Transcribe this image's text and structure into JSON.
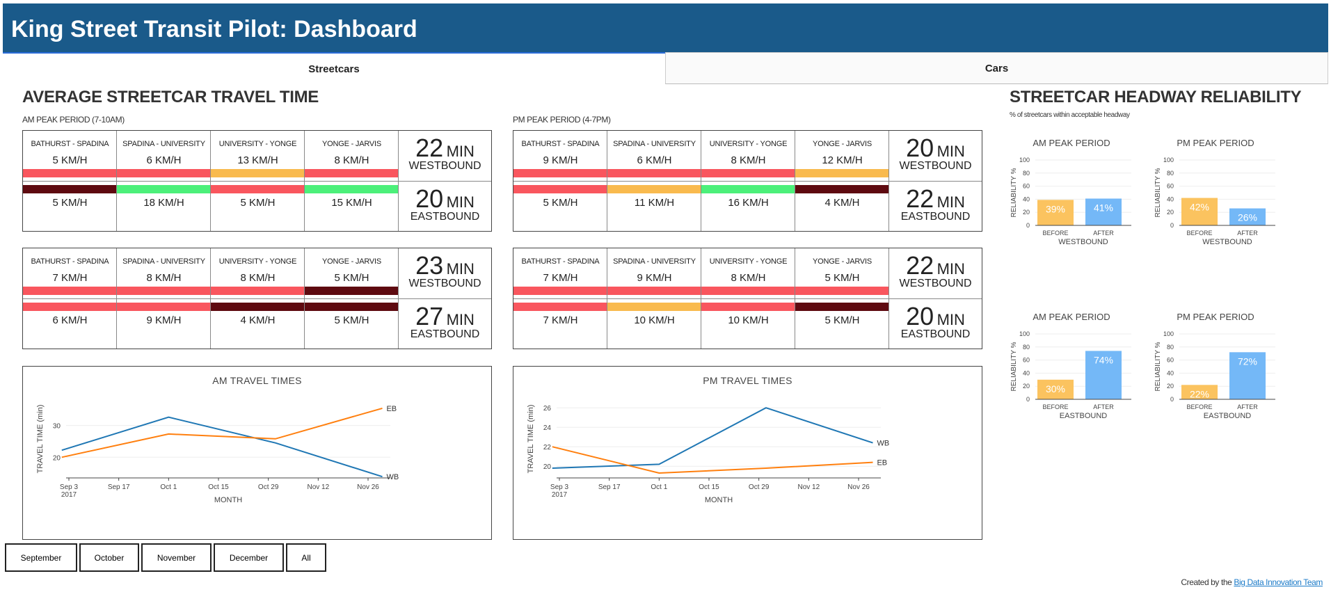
{
  "header": {
    "title": "King Street Transit Pilot: Dashboard"
  },
  "tabs": [
    {
      "label": "Streetcars",
      "active": true
    },
    {
      "label": "Cars",
      "active": false
    }
  ],
  "travel_time": {
    "title": "AVERAGE STREETCAR TRAVEL TIME",
    "am_label": "AM PEAK PERIOD (7-10AM)",
    "pm_label": "PM PEAK PERIOD (4-7PM)",
    "unit": "MIN",
    "colors": {
      "red": "#f9565e",
      "orange": "#f9ba4e",
      "green": "#4cf07a",
      "dark": "#5e0a10"
    },
    "tables": [
      {
        "segments": [
          {
            "name": "BATHURST - SPADINA",
            "wb": "5 KM/H",
            "wb_color": "red",
            "eb": "5 KM/H",
            "eb_color": "dark"
          },
          {
            "name": "SPADINA - UNIVERSITY",
            "wb": "6 KM/H",
            "wb_color": "red",
            "eb": "18 KM/H",
            "eb_color": "green"
          },
          {
            "name": "UNIVERSITY - YONGE",
            "wb": "13 KM/H",
            "wb_color": "orange",
            "eb": "5 KM/H",
            "eb_color": "red"
          },
          {
            "name": "YONGE - JARVIS",
            "wb": "8 KM/H",
            "wb_color": "red",
            "eb": "15 KM/H",
            "eb_color": "green"
          }
        ],
        "wb_total": "22",
        "eb_total": "20",
        "wb_label": "WESTBOUND",
        "eb_label": "EASTBOUND"
      },
      {
        "segments": [
          {
            "name": "BATHURST - SPADINA",
            "wb": "9 KM/H",
            "wb_color": "red",
            "eb": "5 KM/H",
            "eb_color": "red"
          },
          {
            "name": "SPADINA - UNIVERSITY",
            "wb": "6 KM/H",
            "wb_color": "red",
            "eb": "11 KM/H",
            "eb_color": "orange"
          },
          {
            "name": "UNIVERSITY - YONGE",
            "wb": "8 KM/H",
            "wb_color": "red",
            "eb": "16 KM/H",
            "eb_color": "green"
          },
          {
            "name": "YONGE - JARVIS",
            "wb": "12 KM/H",
            "wb_color": "orange",
            "eb": "4 KM/H",
            "eb_color": "dark"
          }
        ],
        "wb_total": "20",
        "eb_total": "22",
        "wb_label": "WESTBOUND",
        "eb_label": "EASTBOUND"
      },
      {
        "segments": [
          {
            "name": "BATHURST - SPADINA",
            "wb": "7 KM/H",
            "wb_color": "red",
            "eb": "6 KM/H",
            "eb_color": "red"
          },
          {
            "name": "SPADINA - UNIVERSITY",
            "wb": "8 KM/H",
            "wb_color": "red",
            "eb": "9 KM/H",
            "eb_color": "red"
          },
          {
            "name": "UNIVERSITY - YONGE",
            "wb": "8 KM/H",
            "wb_color": "red",
            "eb": "4 KM/H",
            "eb_color": "dark"
          },
          {
            "name": "YONGE - JARVIS",
            "wb": "5 KM/H",
            "wb_color": "dark",
            "eb": "5 KM/H",
            "eb_color": "dark"
          }
        ],
        "wb_total": "23",
        "eb_total": "27",
        "wb_label": "WESTBOUND",
        "eb_label": "EASTBOUND"
      },
      {
        "segments": [
          {
            "name": "BATHURST - SPADINA",
            "wb": "7 KM/H",
            "wb_color": "red",
            "eb": "7 KM/H",
            "eb_color": "red"
          },
          {
            "name": "SPADINA - UNIVERSITY",
            "wb": "9 KM/H",
            "wb_color": "red",
            "eb": "10 KM/H",
            "eb_color": "orange"
          },
          {
            "name": "UNIVERSITY - YONGE",
            "wb": "8 KM/H",
            "wb_color": "red",
            "eb": "10 KM/H",
            "eb_color": "red"
          },
          {
            "name": "YONGE - JARVIS",
            "wb": "5 KM/H",
            "wb_color": "red",
            "eb": "5 KM/H",
            "eb_color": "dark"
          }
        ],
        "wb_total": "22",
        "eb_total": "20",
        "wb_label": "WESTBOUND",
        "eb_label": "EASTBOUND"
      }
    ]
  },
  "headway": {
    "title": "STREETCAR HEADWAY RELIABILITY",
    "subtitle": "% of streetcars within acceptable headway"
  },
  "months": [
    "September",
    "October",
    "November",
    "December",
    "All"
  ],
  "footer": {
    "prefix": "Created by the",
    "link": "Big Data Innovation Team"
  },
  "chart_data": [
    {
      "type": "line",
      "title": "AM TRAVEL TIMES",
      "xlabel": "MONTH",
      "ylabel": "TRAVEL TIME (min)",
      "x": [
        "2017-09-01",
        "2017-10-01",
        "2017-10-31",
        "2017-11-30"
      ],
      "x_ticks": [
        "Sep 3\n2017",
        "Sep 17",
        "Oct 1",
        "Oct 15",
        "Oct 29",
        "Nov 12",
        "Nov 26"
      ],
      "y_ticks": [
        20,
        30
      ],
      "ylim": [
        13.5,
        38
      ],
      "series": [
        {
          "name": "WB",
          "color": "#1f77b4",
          "values": [
            22.2,
            32.6,
            24.5,
            13.9
          ]
        },
        {
          "name": "EB",
          "color": "#ff7f0e",
          "values": [
            20.0,
            27.3,
            25.8,
            35.4
          ]
        }
      ]
    },
    {
      "type": "line",
      "title": "PM TRAVEL TIMES",
      "xlabel": "MONTH",
      "ylabel": "TRAVEL TIME (min)",
      "x": [
        "2017-09-01",
        "2017-10-01",
        "2017-10-31",
        "2017-11-30"
      ],
      "x_ticks": [
        "Sep 3\n2017",
        "Sep 17",
        "Oct 1",
        "Oct 15",
        "Oct 29",
        "Nov 12",
        "Nov 26"
      ],
      "y_ticks": [
        20,
        22,
        24,
        26
      ],
      "ylim": [
        18.8,
        26.8
      ],
      "series": [
        {
          "name": "WB",
          "color": "#1f77b4",
          "values": [
            19.8,
            20.2,
            26.0,
            22.4
          ]
        },
        {
          "name": "EB",
          "color": "#ff7f0e",
          "values": [
            22.0,
            19.3,
            19.8,
            20.4
          ]
        }
      ]
    },
    {
      "type": "bar",
      "title": "AM PEAK PERIOD",
      "xlabel": "WESTBOUND",
      "ylabel": "RELIABILITY %",
      "categories": [
        "BEFORE",
        "AFTER"
      ],
      "values": [
        39,
        41
      ],
      "labels": [
        "39%",
        "41%"
      ],
      "ylim": [
        0,
        100
      ],
      "y_ticks": [
        0,
        20,
        40,
        60,
        80,
        100
      ],
      "colors": [
        "#fbc35f",
        "#74b8f7"
      ]
    },
    {
      "type": "bar",
      "title": "PM PEAK PERIOD",
      "xlabel": "WESTBOUND",
      "ylabel": "RELIABILITY %",
      "categories": [
        "BEFORE",
        "AFTER"
      ],
      "values": [
        42,
        26
      ],
      "labels": [
        "42%",
        "26%"
      ],
      "ylim": [
        0,
        100
      ],
      "y_ticks": [
        0,
        20,
        40,
        60,
        80,
        100
      ],
      "colors": [
        "#fbc35f",
        "#74b8f7"
      ]
    },
    {
      "type": "bar",
      "title": "AM PEAK PERIOD",
      "xlabel": "EASTBOUND",
      "ylabel": "RELIABILITY %",
      "categories": [
        "BEFORE",
        "AFTER"
      ],
      "values": [
        30,
        74
      ],
      "labels": [
        "30%",
        "74%"
      ],
      "ylim": [
        0,
        100
      ],
      "y_ticks": [
        0,
        20,
        40,
        60,
        80,
        100
      ],
      "colors": [
        "#fbc35f",
        "#74b8f7"
      ]
    },
    {
      "type": "bar",
      "title": "PM PEAK PERIOD",
      "xlabel": "EASTBOUND",
      "ylabel": "RELIABILITY %",
      "categories": [
        "BEFORE",
        "AFTER"
      ],
      "values": [
        22,
        72
      ],
      "labels": [
        "22%",
        "72%"
      ],
      "ylim": [
        0,
        100
      ],
      "y_ticks": [
        0,
        20,
        40,
        60,
        80,
        100
      ],
      "colors": [
        "#fbc35f",
        "#74b8f7"
      ]
    }
  ]
}
